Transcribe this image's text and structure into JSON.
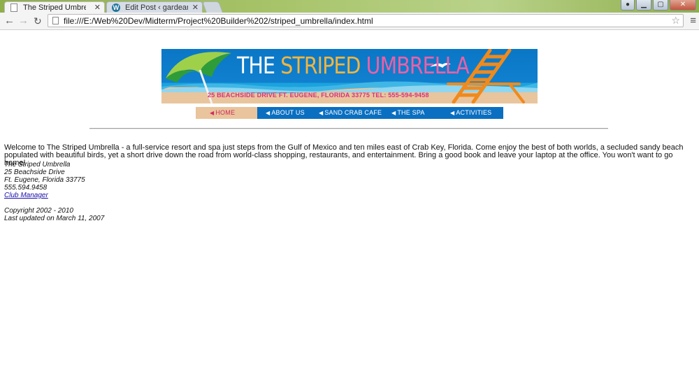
{
  "browser": {
    "tabs": [
      {
        "label": "The Striped Umbrella beac",
        "active": true
      },
      {
        "label": "Edit Post ‹ gardeangie —",
        "active": false
      }
    ],
    "url": "file:///E:/Web%20Dev/Midterm/Project%20Builder%202/striped_umbrella/index.html",
    "window_controls": {
      "minimize": "▁",
      "maximize": "▢",
      "close": "✕"
    }
  },
  "banner": {
    "title_the": "THE ",
    "title_striped": "STRIPED ",
    "title_umbrella": "UMBRELLA",
    "address": "25 BEACHSIDE DRIVE   FT. EUGENE, FLORIDA 33775    TEL: 555-594-9458"
  },
  "nav": {
    "items": [
      {
        "label": "HOME"
      },
      {
        "label": "ABOUT US"
      },
      {
        "label": "SAND CRAB CAFE"
      },
      {
        "label": "THE SPA"
      },
      {
        "label": "ACTIVITIES"
      }
    ]
  },
  "content": {
    "intro": "Welcome to The Striped Umbrella - a full-service resort and spa just steps from the Gulf of Mexico and ten miles east of Crab Key, Florida. Come enjoy the best of both worlds, a secluded sandy beach populated with beautiful birds, yet a short drive down the road from world-class shopping, restaurants, and entertainment. Bring a good book and leave your laptop at the office. You won't want to go home!",
    "contact": {
      "name": "The Striped Umbrella",
      "street": "25 Beachside Drive",
      "city": "Ft. Eugene, Florida 33775",
      "phone": "555.594.9458",
      "link": "Club Manager"
    },
    "footer": {
      "copyright": "Copyright 2002 - 2010",
      "updated": "Last updated on March 11, 2007"
    }
  },
  "colors": {
    "banner_blue": "#0a77c6",
    "sand": "#e9c59d",
    "nav_blue": "#0a6fc0",
    "accent_pink": "#ef5fa5",
    "accent_orange": "#f3b53c"
  }
}
